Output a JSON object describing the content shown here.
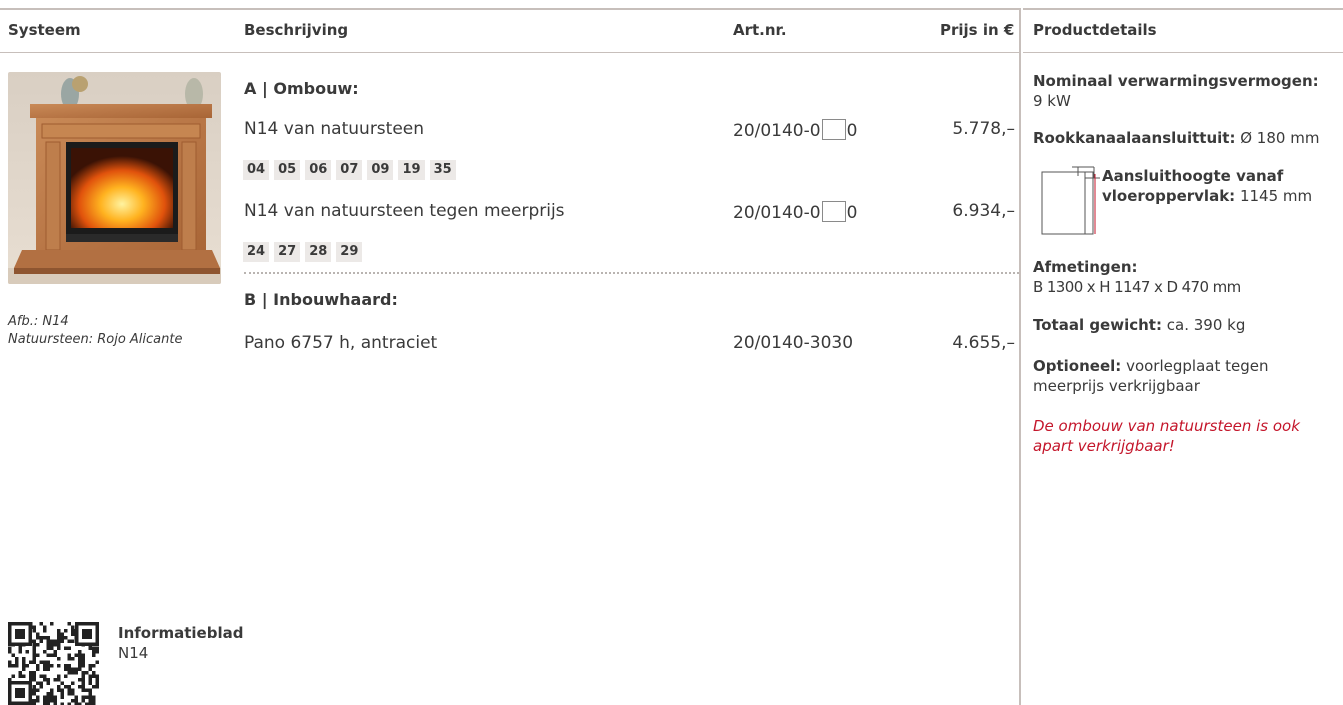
{
  "header": {
    "col_system": "Systeem",
    "col_description": "Beschrijving",
    "col_artnr": "Art.nr.",
    "col_price": "Prijs in €",
    "col_details": "Productdetails"
  },
  "image": {
    "caption_line1": "Afb.: N14",
    "caption_line2": "Natuursteen: Rojo Alicante"
  },
  "section_a": {
    "title": "A | Ombouw:",
    "rows": [
      {
        "description": "N14 van natuursteen",
        "art_prefix": "20/0140-0",
        "art_suffix": "0",
        "price": "5.778,–",
        "codes": [
          "04",
          "05",
          "06",
          "07",
          "09",
          "19",
          "35"
        ]
      },
      {
        "description": "N14 van natuursteen tegen meerprijs",
        "art_prefix": "20/0140-0",
        "art_suffix": "0",
        "price": "6.934,–",
        "codes": [
          "24",
          "27",
          "28",
          "29"
        ]
      }
    ]
  },
  "section_b": {
    "title": "B | Inbouwhaard:",
    "rows": [
      {
        "description": "Pano 6757 h, antraciet",
        "artnr": "20/0140-3030",
        "price": "4.655,–"
      }
    ]
  },
  "details": {
    "power_label": "Nominaal verwarmingsvermogen:",
    "power_value": "9 kW",
    "flue_label": "Rookkanaalaansluittuit:",
    "flue_value": "Ø 180 mm",
    "height_label_line1": "Aansluithoogte vanaf",
    "height_label_line2": "vloeroppervlak:",
    "height_value": "1145 mm",
    "dims_label": "Afmetingen:",
    "dims_value": "B 1300 x H 1147 x D 470 mm",
    "weight_label": "Totaal gewicht:",
    "weight_value": "ca. 390 kg",
    "optional_label": "Optioneel:",
    "optional_value_line1": "voorlegplaat tegen",
    "optional_value_line2": "meerprijs verkrijgbaar",
    "note_line1": "De ombouw van natuursteen is ook",
    "note_line2": "apart verkrijgbaar!"
  },
  "info": {
    "title": "Informatieblad",
    "subtitle": "N14"
  },
  "colors": {
    "accent_red": "#c4162b",
    "rule_gray": "#c7bfbb",
    "code_bg": "#ece9e7",
    "text": "#3a3a3a"
  }
}
